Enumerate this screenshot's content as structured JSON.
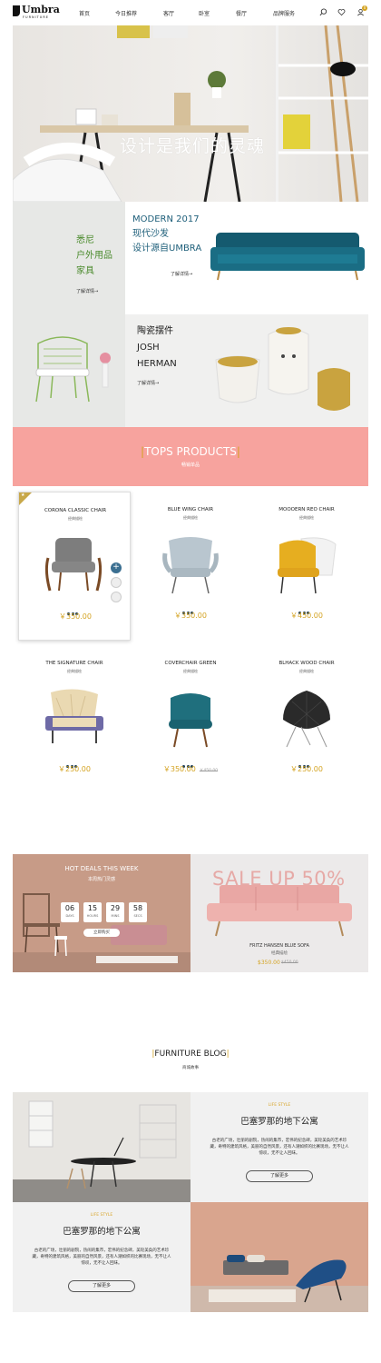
{
  "header": {
    "logo": "Umbra",
    "logo_sub": "FURNITURE",
    "nav": [
      "首页",
      "今日推荐",
      "客厅",
      "卧室",
      "餐厅",
      "品牌服务"
    ],
    "cart_count": "0"
  },
  "hero": {
    "title": "设计是我们的灵魂"
  },
  "promo1": {
    "left_lines": [
      "悉尼",
      "户外用品",
      "家具"
    ],
    "left_more": "了解详情→",
    "right_lines": [
      "MODERN 2017",
      "现代沙发",
      "设计源自UMBRA"
    ],
    "right_more": "了解详情→"
  },
  "promo2": {
    "lines": [
      "陶瓷摆件",
      "JOSH",
      "HERMAN"
    ],
    "more": "了解详情→"
  },
  "tops": {
    "title": "TOPS PRODUCTS",
    "subtitle": "畅销单品"
  },
  "products": [
    {
      "name": "CORONA CLASSIC CHAIR",
      "sub": "经典描绘",
      "price": "￥350.00",
      "old": ""
    },
    {
      "name": "BLUE WING CHAIR",
      "sub": "经典描绘",
      "price": "￥350.00",
      "old": ""
    },
    {
      "name": "MOOOERN REO CHAIR",
      "sub": "经典描绘",
      "price": "￥450.00",
      "old": ""
    },
    {
      "name": "THE SIGNATURE CHAIR",
      "sub": "经典描绘",
      "price": "￥250.00",
      "old": ""
    },
    {
      "name": "COVERCHAIR GREEN",
      "sub": "经典描绘",
      "price": "￥350.00",
      "old": "￥450.00"
    },
    {
      "name": "BLHACK WOOD CHAIR",
      "sub": "经典描绘",
      "price": "￥250.00",
      "old": ""
    }
  ],
  "deals": {
    "title": "HOT DEALS THIS WEEK",
    "subtitle": "本周热门灵感",
    "countdown": [
      {
        "value": "06",
        "label": "DAYS"
      },
      {
        "value": "15",
        "label": "HOURS"
      },
      {
        "value": "29",
        "label": "MINS"
      },
      {
        "value": "58",
        "label": "SECS"
      }
    ],
    "buy": "立即购买",
    "sale_text": "SALE UP 50%",
    "product_name": "FRITZ HANSEN  BLUE SOFA",
    "product_sub": "经典描绘",
    "price": "$350.00",
    "old_price": "$450.00"
  },
  "blog": {
    "title": "FURNITURE BLOG",
    "subtitle": "商城故事",
    "posts": [
      {
        "style": "LIFE STYLE",
        "title": "巴塞罗那的地下公寓",
        "body": "古老的广场，壮丽的剧院，热闹的集市，宏伟的纪念碑，美轮美奂的艺术珍藏，奇特的建筑风格，美丽的自然风景，还有人潮如织的比赛现场，无不让人惊叹，无不让人回味。",
        "button": "了解更多"
      },
      {
        "style": "LIFE STYLE",
        "title": "巴塞罗那的地下公寓",
        "body": "古老的广场，壮丽的剧院，热闹的集市，宏伟的纪念碑，美轮美奂的艺术珍藏，奇特的建筑风格，美丽的自然风景，还有人潮如织的比赛现场，无不让人惊叹，无不让人回味。",
        "button": "了解更多"
      }
    ]
  },
  "colors": {
    "accent": "#d4a321",
    "pink": "#f7a39e",
    "green": "#4a8a2c",
    "teal": "#1e5f7a"
  }
}
